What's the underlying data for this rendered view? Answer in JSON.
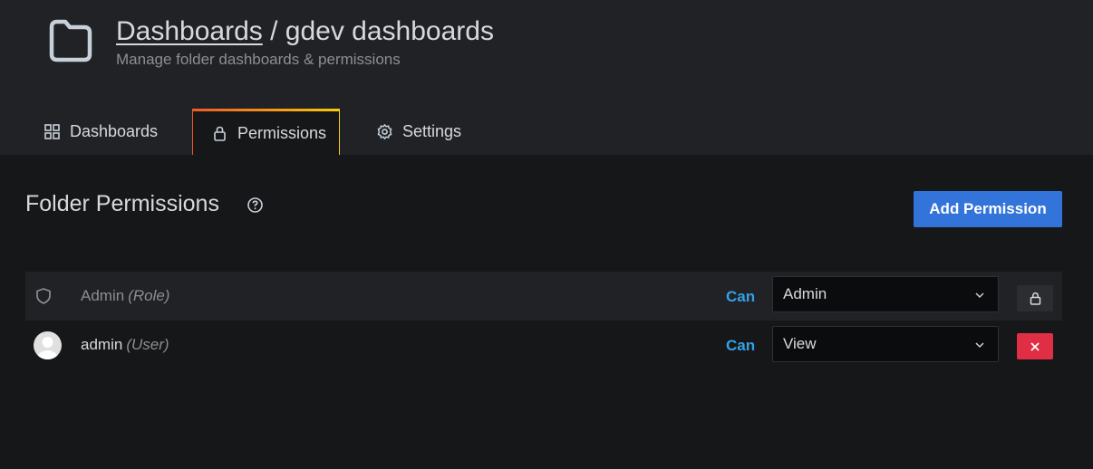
{
  "header": {
    "breadcrumb_link": "Dashboards",
    "separator": " / ",
    "folder_name": "gdev dashboards",
    "subtitle": "Manage folder dashboards & permissions",
    "icon": "folder-icon"
  },
  "tabs": [
    {
      "label": "Dashboards",
      "icon": "grid-icon",
      "active": false
    },
    {
      "label": "Permissions",
      "icon": "lock-icon",
      "active": true
    },
    {
      "label": "Settings",
      "icon": "gear-icon",
      "active": false
    }
  ],
  "section": {
    "title": "Folder Permissions",
    "help_icon": "question-circle-icon",
    "add_button": "Add Permission"
  },
  "permissions": [
    {
      "name": "Admin",
      "type": "(Role)",
      "icon": "shield-icon",
      "can": "Can",
      "level": "Admin",
      "action_icon": "lock-icon",
      "locked": true
    },
    {
      "name": "admin",
      "type": "(User)",
      "icon": "avatar",
      "can": "Can",
      "level": "View",
      "action_icon": "close-icon",
      "locked": false
    }
  ],
  "colors": {
    "accent": "#3274d9",
    "can_text": "#33a2e5",
    "danger": "#e02f44",
    "tab_gradient_start": "#f05a28",
    "tab_gradient_end": "#fbca0a"
  }
}
